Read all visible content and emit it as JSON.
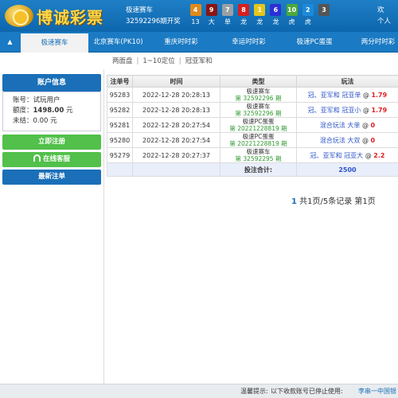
{
  "header": {
    "logo_text": "博诚彩票",
    "game_name": "极速赛车",
    "issue_text": "32592296期开奖",
    "balls": [
      {
        "num": "4",
        "color": "#e08a1a",
        "label": "13"
      },
      {
        "num": "9",
        "color": "#8a1414",
        "label": "大"
      },
      {
        "num": "7",
        "color": "#9aa0a6",
        "label": "单"
      },
      {
        "num": "8",
        "color": "#d81e1e",
        "label": "龙"
      },
      {
        "num": "1",
        "color": "#e6c51a",
        "label": "龙"
      },
      {
        "num": "6",
        "color": "#2b2fd6",
        "label": "龙"
      },
      {
        "num": "10",
        "color": "#4caa3a",
        "label": "虎"
      },
      {
        "num": "2",
        "color": "#1c8ad9",
        "label": "虎"
      },
      {
        "num": "3",
        "color": "#555555",
        "label": ""
      }
    ],
    "right_line1": "欢",
    "right_line2": "个人"
  },
  "nav": {
    "arrow": "▲",
    "tabs": [
      {
        "label": "极速赛车",
        "active": true
      },
      {
        "label": "北京赛车(PK10)",
        "active": false
      },
      {
        "label": "重庆时时彩",
        "active": false
      },
      {
        "label": "幸运时时彩",
        "active": false
      },
      {
        "label": "极速PC蛋蛋",
        "active": false
      },
      {
        "label": "两分时时彩",
        "active": false
      }
    ]
  },
  "subnav": {
    "items": [
      "两面盘",
      "1~10定位",
      "冠亚军和"
    ],
    "sep": "|"
  },
  "sidebar": {
    "title": "账户信息",
    "account_label": "账号：",
    "account_value": "试玩用户",
    "quota_label": "额度：",
    "quota_value": "1498.00",
    "quota_unit": "元",
    "unsettled_label": "未结：",
    "unsettled_value": "0.00 元",
    "register_btn": "立即注册",
    "service_btn": "在线客服",
    "latest_btn": "最新注单"
  },
  "table": {
    "headers": [
      "注单号",
      "时间",
      "类型",
      "玩法"
    ],
    "rows": [
      {
        "id": "95283",
        "time": "2022-12-28 20:28:13",
        "type": "极速赛车",
        "period": "第 32592296 期",
        "play": "冠、亚军和 冠亚单",
        "odds": "1.79"
      },
      {
        "id": "95282",
        "time": "2022-12-28 20:28:13",
        "type": "极速赛车",
        "period": "第 32592296 期",
        "play": "冠、亚军和 冠亚小",
        "odds": "1.79"
      },
      {
        "id": "95281",
        "time": "2022-12-28 20:27:54",
        "type": "极速PC蛋蛋",
        "period": "第 20221228819 期",
        "play": "混合玩法 大单",
        "odds": "0"
      },
      {
        "id": "95280",
        "time": "2022-12-28 20:27:54",
        "type": "极速PC蛋蛋",
        "period": "第 20221228819 期",
        "play": "混合玩法 大双",
        "odds": "0"
      },
      {
        "id": "95279",
        "time": "2022-12-28 20:27:37",
        "type": "极速赛车",
        "period": "第 32592295 期",
        "play": "冠、亚军和 冠亚大",
        "odds": "2.2"
      }
    ],
    "total_label": "投注合计:",
    "total_value": "2500"
  },
  "pager": {
    "current": "1",
    "summary": "共1页/5条记录 第1页"
  },
  "footer": {
    "tip_label": "温馨提示:",
    "tip_text": "以下收款账号已停止使用:",
    "scroll_text": "李串一中国银"
  }
}
